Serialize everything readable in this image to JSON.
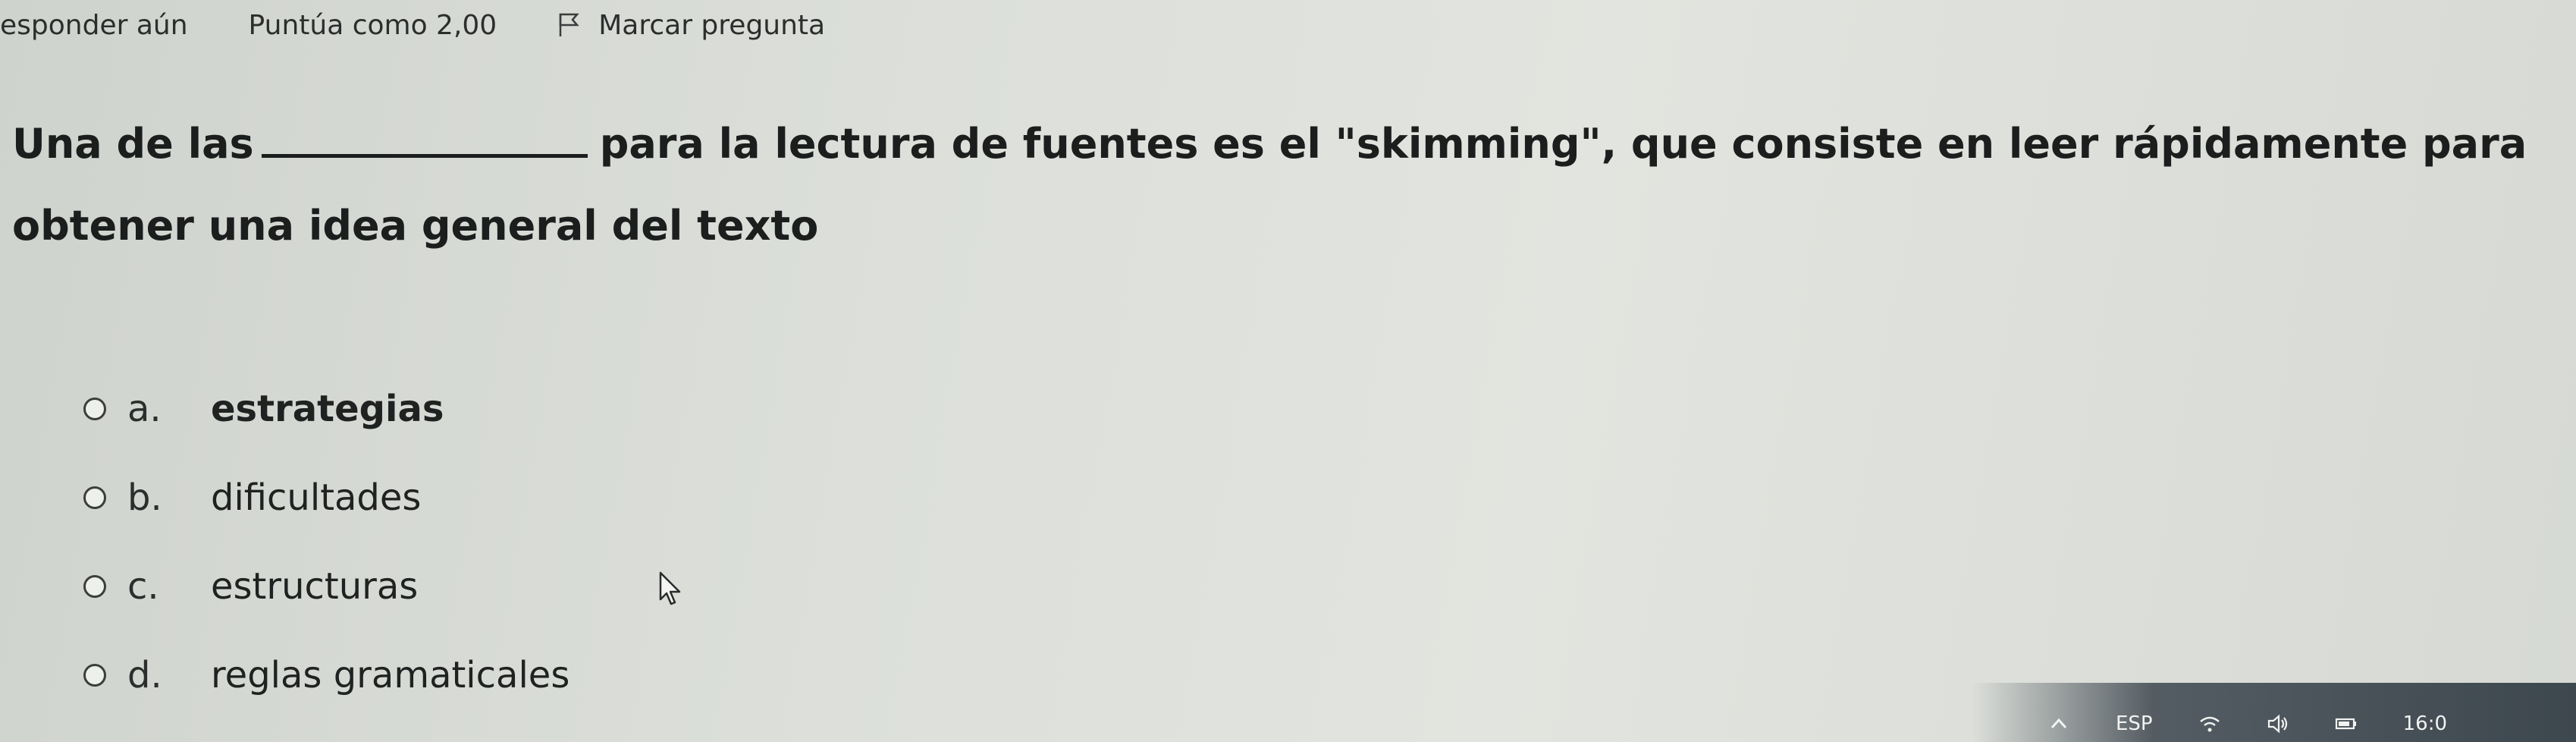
{
  "header": {
    "status": "esponder aún",
    "score": "Puntúa como 2,00",
    "flag_label": "Marcar pregunta"
  },
  "question": {
    "part1": "Una de las",
    "part2": "para la lectura de fuentes es el \"skimming\", que consiste en leer rápidamente para",
    "part3": "obtener una idea general del texto"
  },
  "options": [
    {
      "letter": "a.",
      "text": "estrategias"
    },
    {
      "letter": "b.",
      "text": "dificultades"
    },
    {
      "letter": "c.",
      "text": "estructuras"
    },
    {
      "letter": "d.",
      "text": "reglas gramaticales"
    }
  ],
  "taskbar": {
    "language": "ESP",
    "clock": "16:0",
    "icons": [
      "chevron-up-icon",
      "wifi-icon",
      "speaker-icon",
      "battery-icon"
    ]
  }
}
